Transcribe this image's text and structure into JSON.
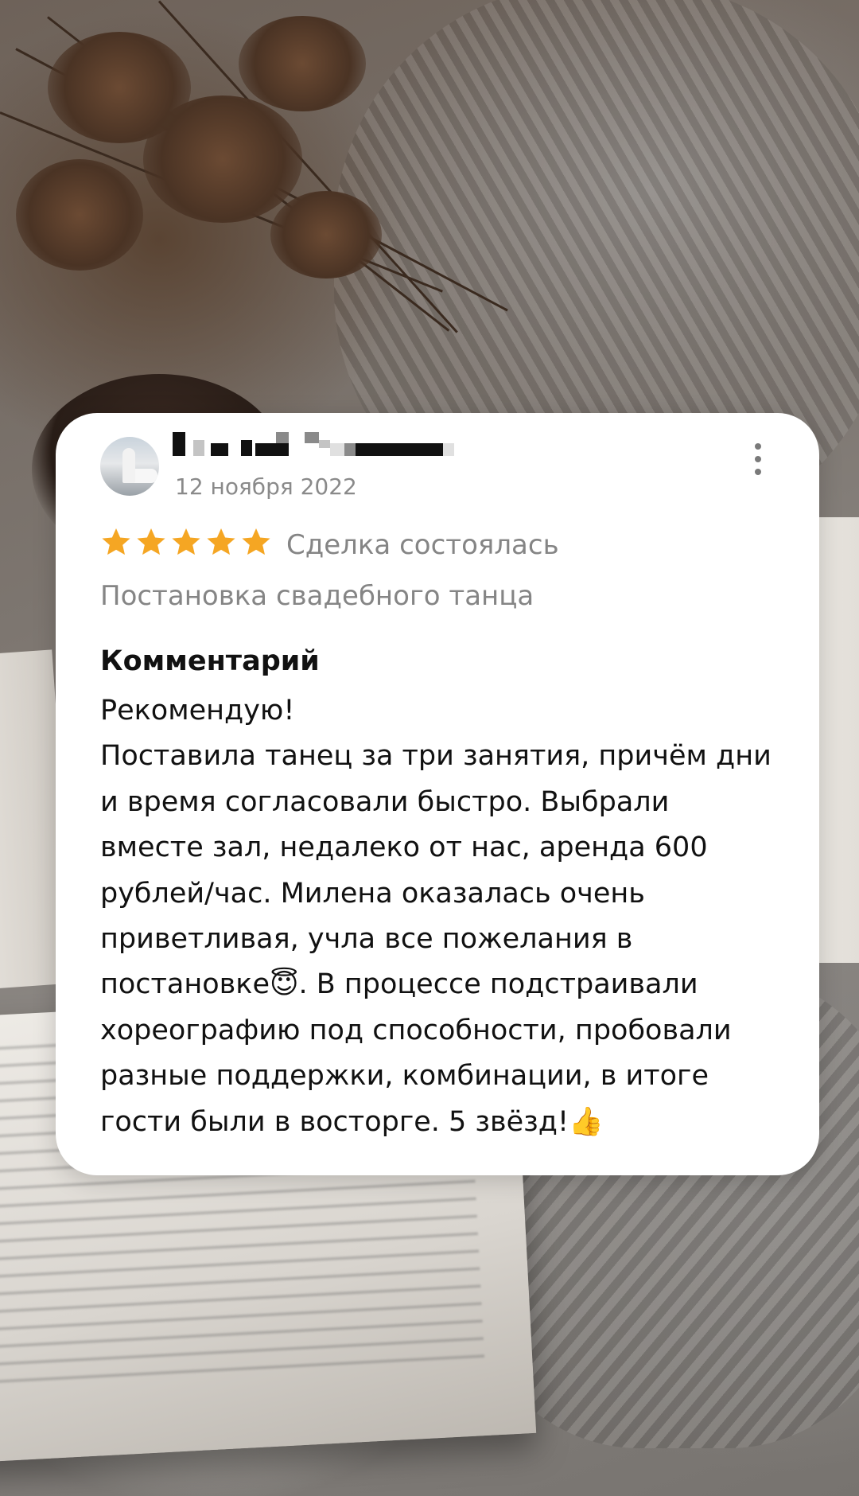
{
  "review": {
    "date": "12 ноября 2022",
    "rating": 5,
    "rating_max": 5,
    "star_color": "#F5A623",
    "deal_status": "Сделка состоялась",
    "service": "Постановка свадебного танца",
    "comment_label": "Комментарий",
    "comment_lines": [
      "Рекомендую!",
      "Поставила танец за три занятия, причём дни",
      "и время согласовали быстро. Выбрали",
      "вместе зал, недалеко от нас, аренда 600",
      "рублей/час. Милена оказалась очень",
      "приветливая, учла все пожелания в",
      "постановке😇. В процессе подстраивали",
      "хореографию под способности, пробовали",
      "разные поддержки, комбинации, в итоге",
      "гости были в восторге. 5 звёзд!👍"
    ],
    "icons": {
      "menu": "more-vertical-icon",
      "star": "star-icon"
    }
  }
}
